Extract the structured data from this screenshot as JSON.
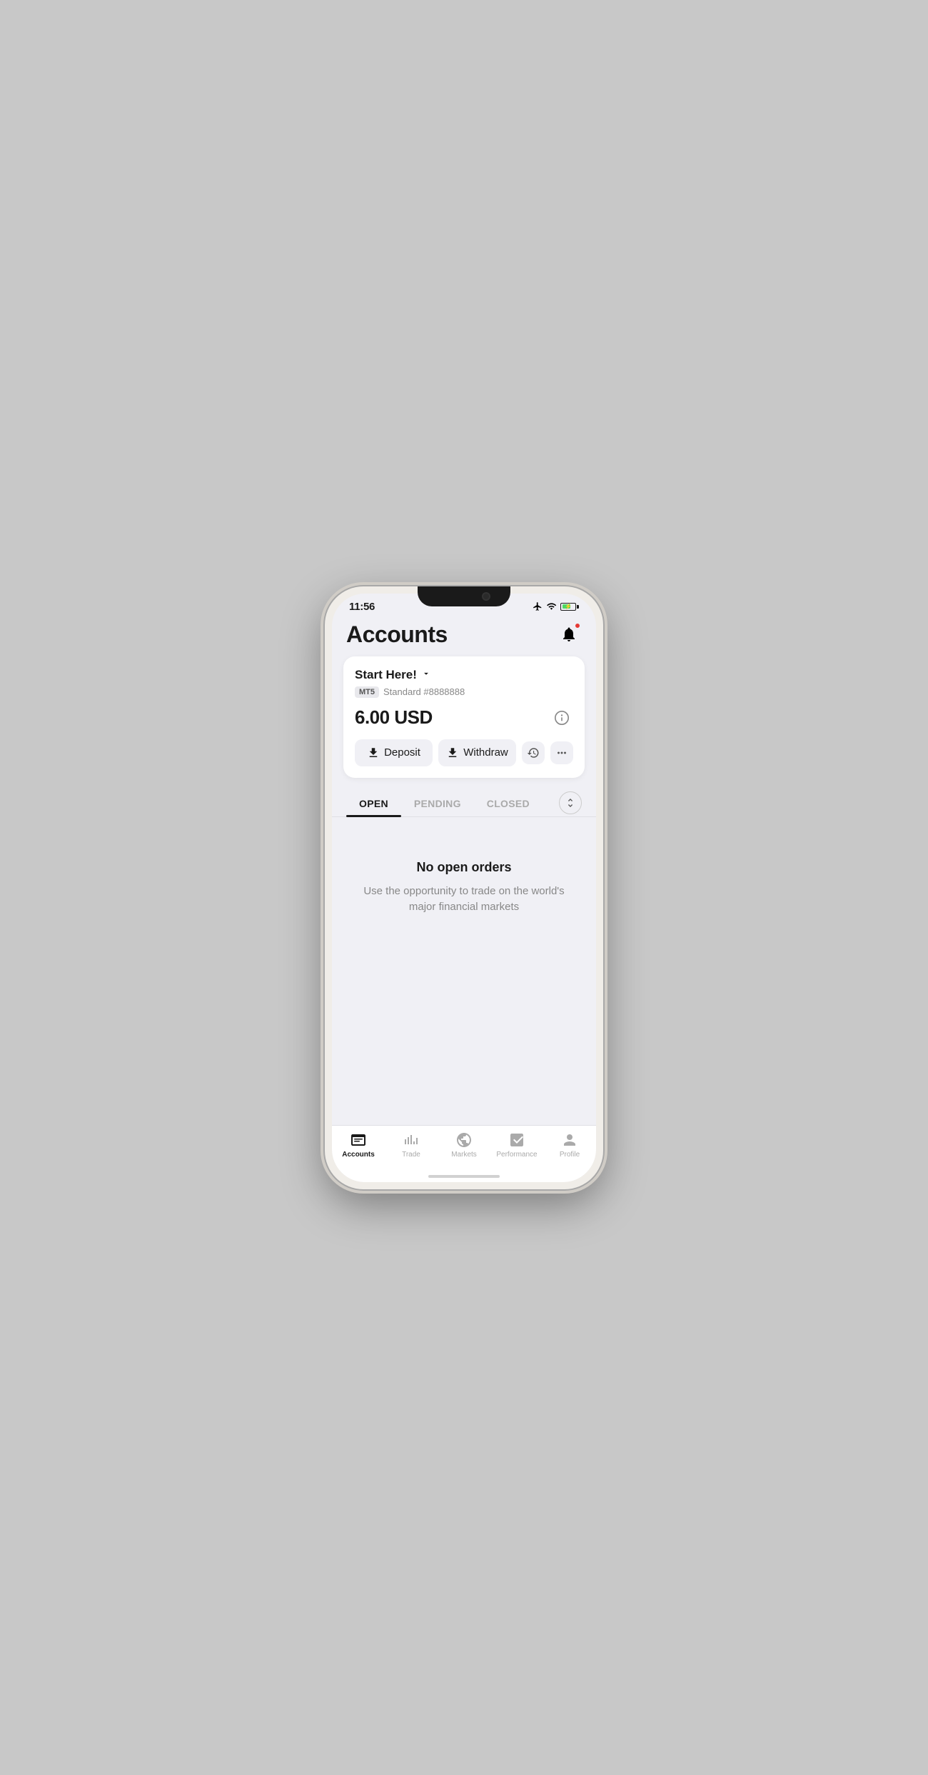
{
  "status_bar": {
    "time": "11:56",
    "icons": [
      "airplane",
      "wifi",
      "battery"
    ]
  },
  "header": {
    "title": "Accounts",
    "notification_badge": true
  },
  "account_card": {
    "account_name": "Start Here!",
    "platform_badge": "MT5",
    "account_type": "Standard",
    "account_number": "#8888888",
    "balance": "6.00 USD",
    "deposit_label": "Deposit",
    "withdraw_label": "Withdraw"
  },
  "tabs": {
    "open_label": "OPEN",
    "pending_label": "PENDING",
    "closed_label": "CLOSED",
    "active": "open"
  },
  "empty_state": {
    "title": "No open orders",
    "description": "Use the opportunity to trade on the world's major financial markets"
  },
  "bottom_nav": {
    "items": [
      {
        "id": "accounts",
        "label": "Accounts",
        "active": true
      },
      {
        "id": "trade",
        "label": "Trade",
        "active": false
      },
      {
        "id": "markets",
        "label": "Markets",
        "active": false
      },
      {
        "id": "performance",
        "label": "Performance",
        "active": false
      },
      {
        "id": "profile",
        "label": "Profile",
        "active": false
      }
    ]
  }
}
